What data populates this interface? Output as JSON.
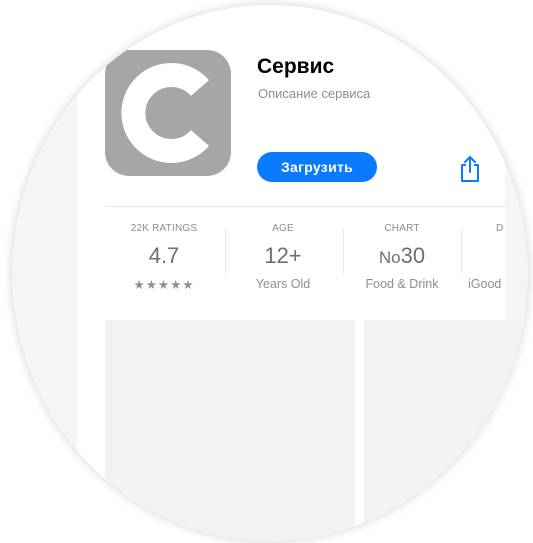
{
  "app": {
    "title": "Сервис",
    "subtitle": "Описание сервиса",
    "get_label": "Загрузить",
    "icon_letter": "C",
    "accent": "#0a7aff",
    "icon_bg": "#a6a6a6"
  },
  "stats": [
    {
      "label": "22K RATINGS",
      "value": "4.7",
      "sub": "★★★★★"
    },
    {
      "label": "AGE",
      "value": "12+",
      "sub": "Years Old"
    },
    {
      "label": "CHART",
      "value_prefix": "No",
      "value": "30",
      "sub": "Food & Drink"
    },
    {
      "label": "D",
      "value": "",
      "sub": "iGood"
    }
  ],
  "icons": {
    "app": "app-logo-icon",
    "share": "share-icon",
    "stars": "rating-stars"
  }
}
